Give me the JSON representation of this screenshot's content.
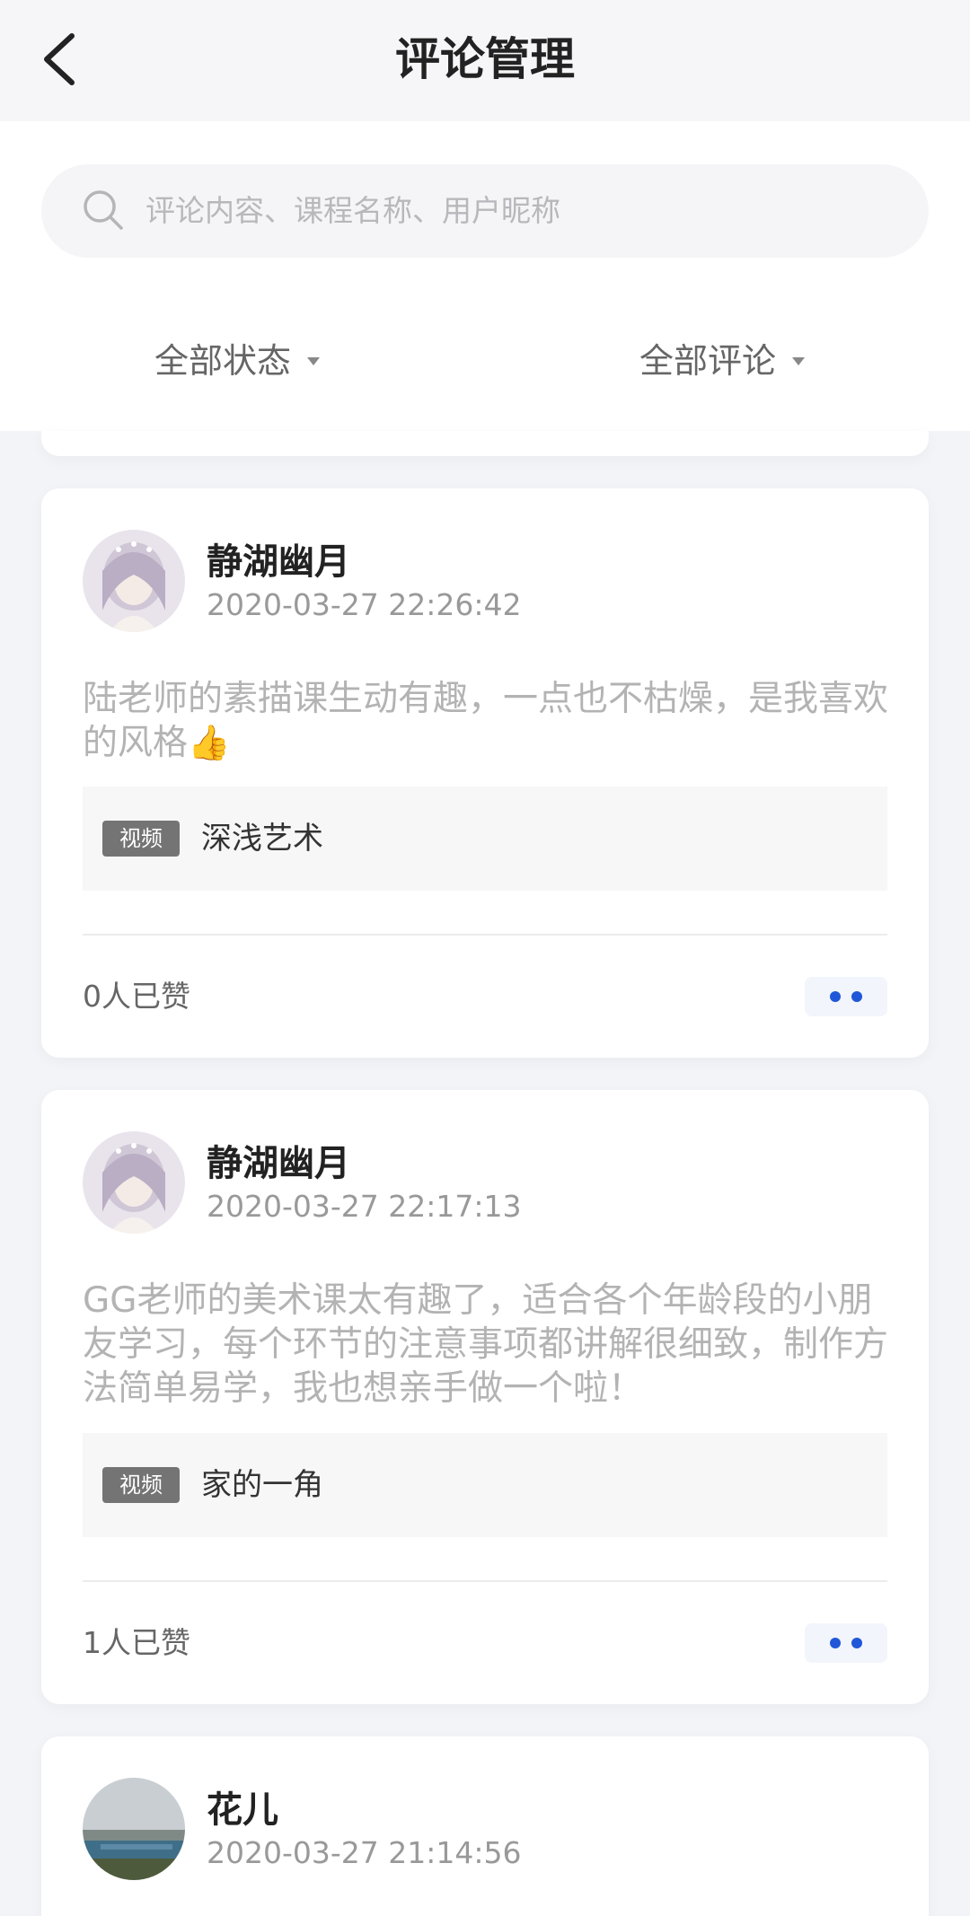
{
  "header": {
    "title": "评论管理"
  },
  "search": {
    "placeholder": "评论内容、课程名称、用户昵称"
  },
  "filters": {
    "status": "全部状态",
    "type": "全部评论"
  },
  "comments": [
    {
      "user": "静湖幽月",
      "time": "2020-03-27 22:26:42",
      "text": "陆老师的素描课生动有趣，一点也不枯燥，是我喜欢的风格",
      "emoji": "👍",
      "tag": "视频",
      "course": "深浅艺术",
      "likes": "0人已赞"
    },
    {
      "user": "静湖幽月",
      "time": "2020-03-27 22:17:13",
      "text": "GG老师的美术课太有趣了，适合各个年龄段的小朋友学习，每个环节的注意事项都讲解很细致，制作方法简单易学，我也想亲手做一个啦！",
      "tag": "视频",
      "course": "家的一角",
      "likes": "1人已赞"
    },
    {
      "user": "花儿",
      "time": "2020-03-27 21:14:56"
    }
  ],
  "colors": {
    "accent": "#1f57d8",
    "background": "#f3f4f8"
  }
}
